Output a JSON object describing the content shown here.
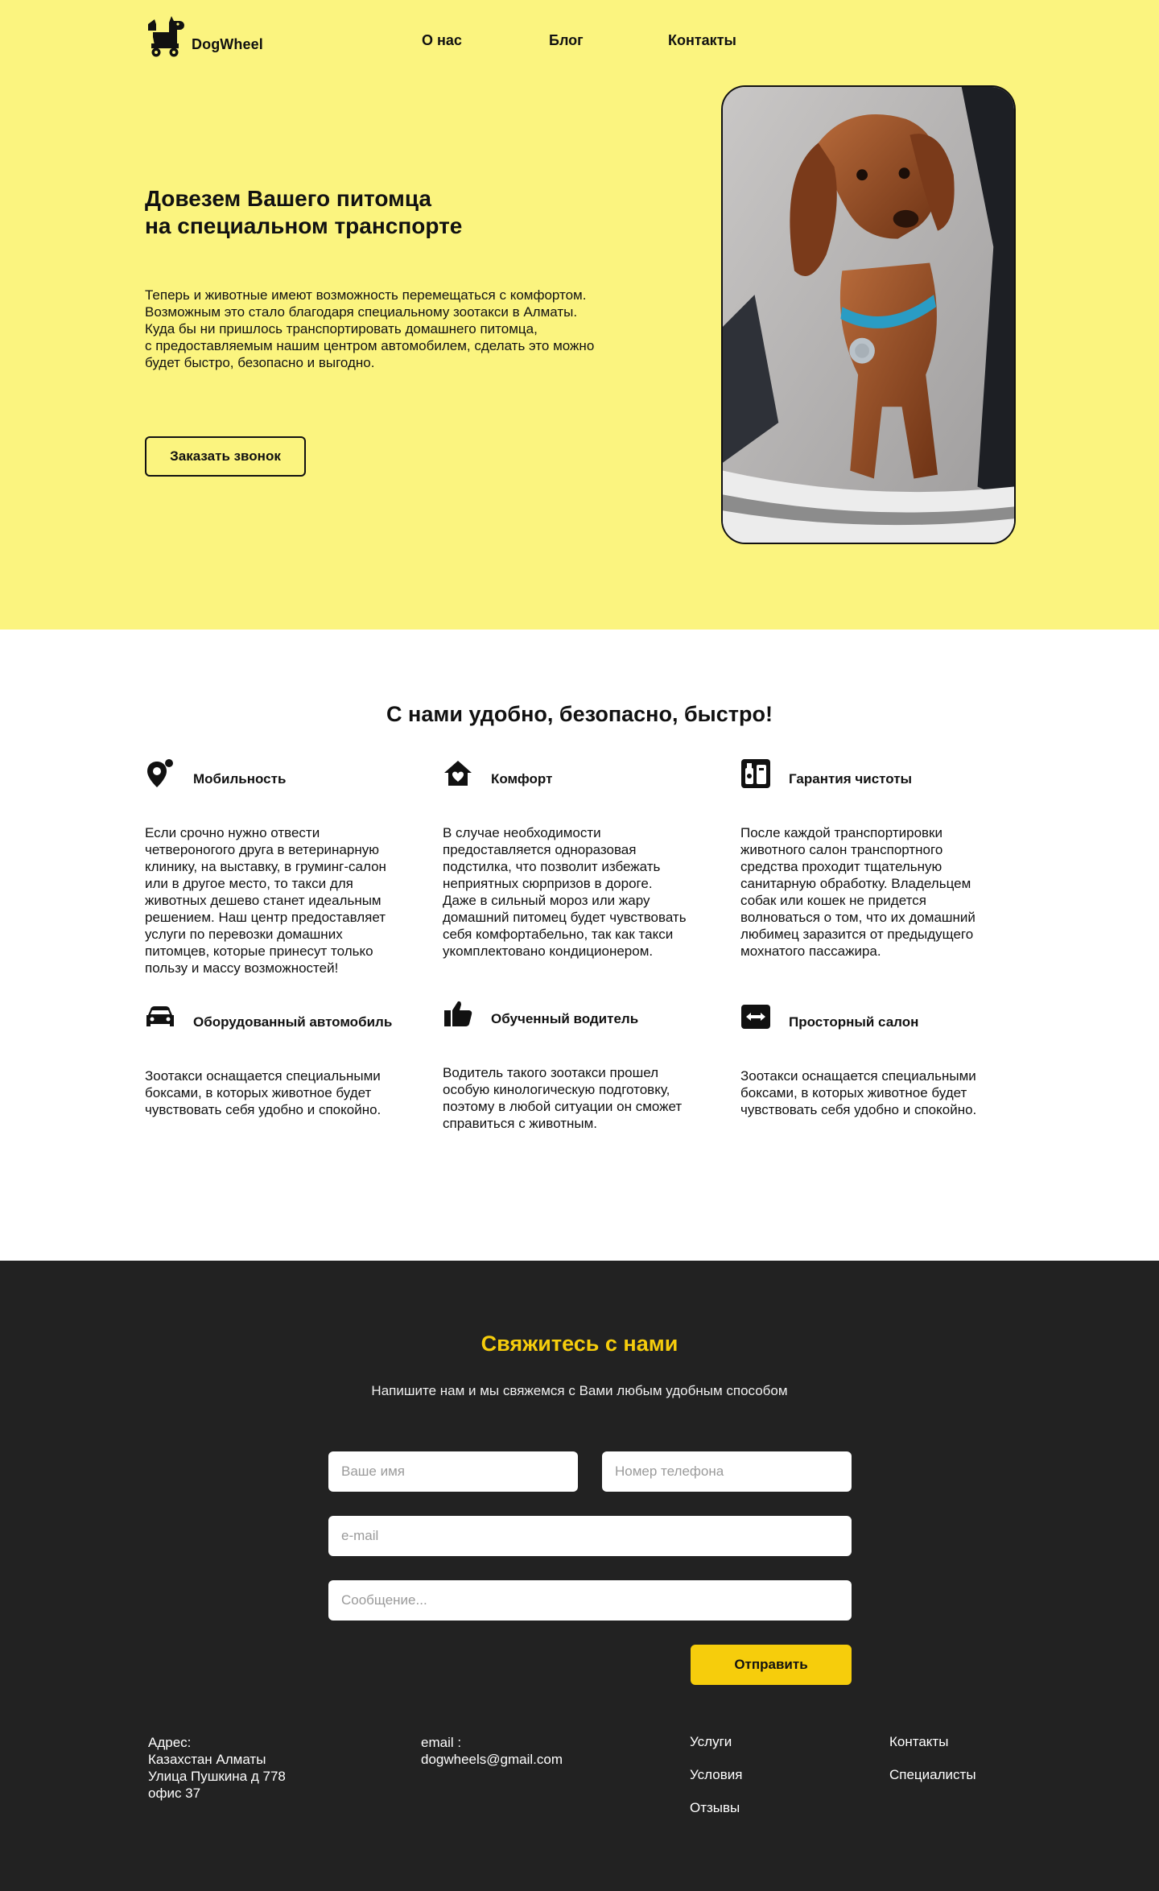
{
  "header": {
    "logo_text": "DogWheel",
    "logo_icon": "dog-on-wheels-icon",
    "nav": [
      {
        "label": "О нас"
      },
      {
        "label": "Блог"
      },
      {
        "label": "Контакты"
      }
    ]
  },
  "hero": {
    "title": "Довезем Вашего питомца\nна специальном транспорте",
    "text": "Теперь и животные имеют возможность перемещаться с комфортом.\nВозможным это стало благодаря специальному зоотакси в Алматы.\nКуда бы ни пришлось транспортировать домашнего питомца,\nс предоставляемым нашим центром автомобилем, сделать это можно\nбудет быстро, безопасно и выгодно.",
    "button_label": "Заказать звонок",
    "colors": {
      "background": "#fbf47f",
      "text": "#111111"
    }
  },
  "features": {
    "title": "С нами удобно, безопасно, быстро!",
    "items": [
      {
        "icon": "location-pin-icon",
        "title": "Мобильность",
        "text": "Если срочно нужно отвести\nчетвероногого друга в ветеринарную\nклинику, на выставку, в груминг-салон\nили в другое место, то такси для\nживотных дешево станет идеальным\nрешением. Наш центр предоставляет\nуслуги по перевозки домашних\nпитомцев, которые принесут только\nпользу и массу возможностей!"
      },
      {
        "icon": "home-heart-icon",
        "title": "Комфорт",
        "text": "В случае необходимости\nпредоставляется одноразовая\nподстилка, что позволит избежать\nнеприятных сюрпризов в дороге.\nДаже в сильный мороз или жару\nдомашний питомец будет чувствовать\nсебя комфортабельно, так как такси\nукомплектовано кондиционером."
      },
      {
        "icon": "cleaning-supplies-icon",
        "title": "Гарантия чистоты",
        "text": "После каждой транспортировки\nживотного салон транспортного\nсредства проходит тщательную\nсанитарную обработку. Владельцем\nсобак или кошек не придется\nволноваться о том, что их домашний\nлюбимец заразится от предыдущего\nмохнатого пассажира."
      },
      {
        "icon": "car-icon",
        "title": "Оборудованный автомобиль",
        "text": "Зоотакси оснащается специальными\nбоксами, в которых животное будет\nчувствовать себя удобно и спокойно."
      },
      {
        "icon": "thumbs-up-icon",
        "title": "Обученный водитель",
        "text": "Водитель такого зоотакси прошел\nособую кинологическую подготовку,\nпоэтому в любой ситуации он сможет\nсправиться с животным."
      },
      {
        "icon": "arrows-horizontal-icon",
        "title": "Просторный салон",
        "text": "Зоотакси оснащается специальными\nбоксами, в которых животное будет\nчувствовать себя удобно и спокойно."
      }
    ]
  },
  "contact": {
    "title": "Свяжитесь с нами",
    "subtitle": "Напишите нам и мы свяжемся с Вами любым удобным способом",
    "form": {
      "name_placeholder": "Ваше имя",
      "phone_placeholder": "Номер телефона",
      "email_placeholder": "e-mail",
      "message_placeholder": "Сообщение...",
      "submit_label": "Отправить"
    },
    "colors": {
      "background": "#222222",
      "accent": "#f6cd0c"
    }
  },
  "footer": {
    "address": "Адрес:\nКазахстан Алматы\nУлица Пушкина д 778\nофис 37",
    "email": "email :\ndogwheels@gmail.com",
    "links_col1": [
      "Услуги",
      "Условия",
      "Отзывы"
    ],
    "links_col2": [
      "Контакты",
      "Специалисты"
    ]
  }
}
